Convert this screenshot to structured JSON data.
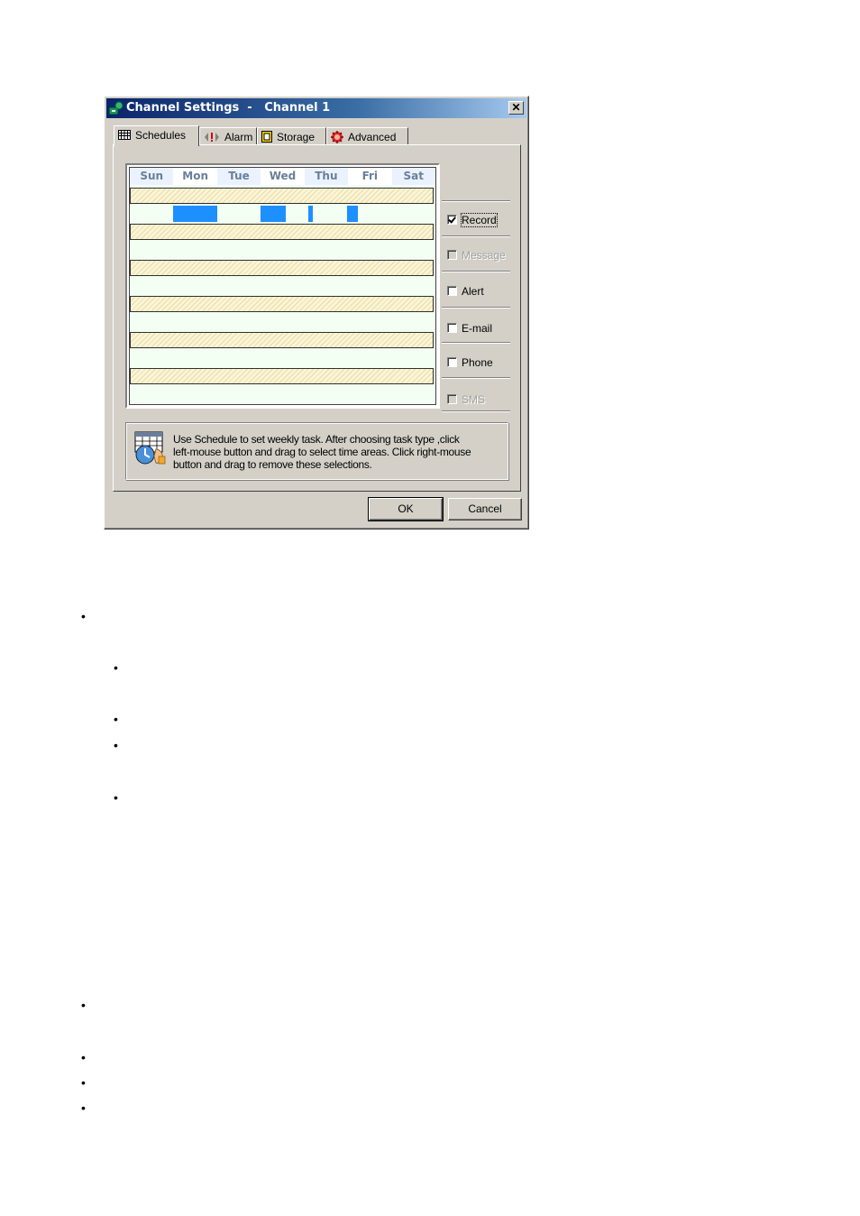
{
  "dialog": {
    "title": "Channel Settings  -   Channel 1",
    "close_label": "✕"
  },
  "tabs": [
    {
      "label": "Schedules",
      "icon": "grid-icon",
      "active": true
    },
    {
      "label": "Alarm",
      "icon": "alarm-icon",
      "active": false
    },
    {
      "label": "Storage",
      "icon": "storage-icon",
      "active": false
    },
    {
      "label": "Advanced",
      "icon": "advanced-gear-icon",
      "active": false
    }
  ],
  "schedule": {
    "days": [
      "Sun",
      "Mon",
      "Tue",
      "Wed",
      "Thu",
      "Fri",
      "Sat"
    ],
    "rows": 6,
    "selections_note": "Record row: selected blocks on Mon, Wed, Thu, Fri"
  },
  "options": [
    {
      "label": "Record",
      "checked": true,
      "disabled": false
    },
    {
      "label": "Message",
      "checked": false,
      "disabled": true
    },
    {
      "label": "Alert",
      "checked": false,
      "disabled": false
    },
    {
      "label": "E-mail",
      "checked": false,
      "disabled": false
    },
    {
      "label": "Phone",
      "checked": false,
      "disabled": false
    },
    {
      "label": "SMS",
      "checked": false,
      "disabled": true
    }
  ],
  "help": {
    "line1": "Use Schedule to set weekly task. After choosing task type ,click",
    "line2": "left-mouse  button and drag to select time areas. Click right-mouse",
    "line3": "button and drag to remove these selections."
  },
  "buttons": {
    "ok": "OK",
    "cancel": "Cancel"
  },
  "colors": {
    "selection": "#1e8fff",
    "title_bar": "#0a246a"
  },
  "bullet_char": "•"
}
